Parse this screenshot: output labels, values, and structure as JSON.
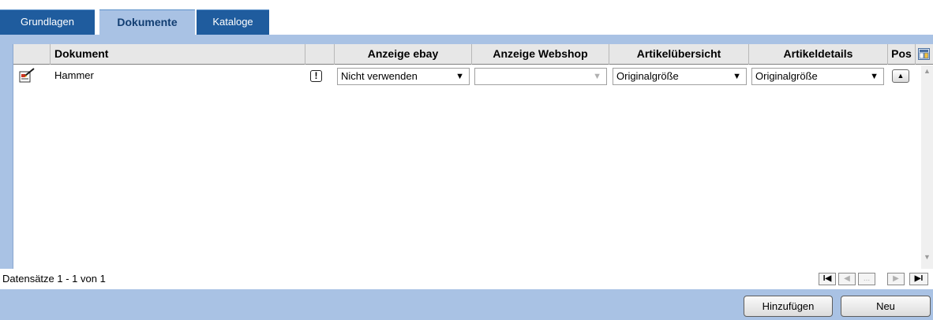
{
  "tabs": [
    {
      "label": "Grundlagen",
      "active": false
    },
    {
      "label": "Dokumente",
      "active": true
    },
    {
      "label": "Kataloge",
      "active": false
    }
  ],
  "grid": {
    "columns": {
      "document": "Dokument",
      "ebay": "Anzeige ebay",
      "webshop": "Anzeige Webshop",
      "overview": "Artikelübersicht",
      "details": "Artikeldetails",
      "pos": "Pos"
    },
    "rows": [
      {
        "name": "Hammer",
        "ebay": "Nicht verwenden",
        "webshop": "",
        "overview": "Originalgröße",
        "details": "Originalgröße"
      }
    ]
  },
  "status": {
    "records": "Datensätze 1 - 1 von 1",
    "pager_ellipsis": "..."
  },
  "buttons": {
    "add": "Hinzufügen",
    "new": "Neu"
  },
  "colors": {
    "tab_bg": "#1f5c9e",
    "tab_active_bg": "#a9c2e4",
    "panel_bg": "#a9c2e4",
    "header_bg": "#e7e7e7"
  }
}
